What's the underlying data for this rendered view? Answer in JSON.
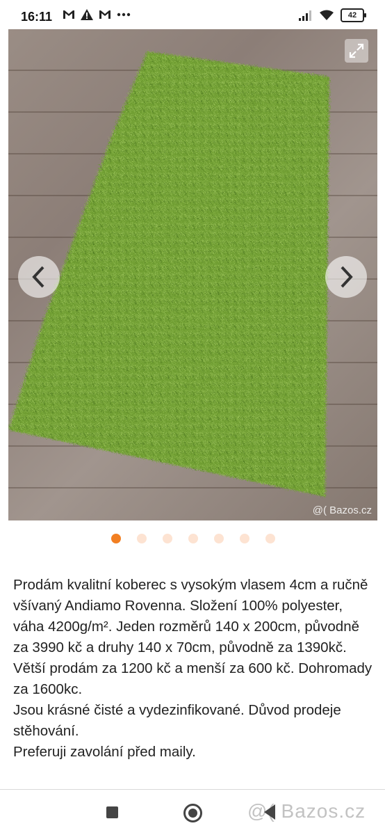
{
  "status_bar": {
    "time": "16:11",
    "left_icons": [
      "gmail-icon",
      "alert-icon",
      "gmail-icon",
      "more-dots-icon"
    ],
    "battery": "42"
  },
  "gallery": {
    "watermark": "@( Bazos.cz",
    "dot_count": 7,
    "active_index": 0,
    "accent": "#f27f22"
  },
  "description": "Prodám kvalitní koberec s vysokým vlasem 4cm a ručně všívaný Andiamo Rovenna. Složení 100% polyester, váha 4200g/m². Jeden rozměrů 140 x 200cm, původně za 3990 kč a druhy 140 x 70cm, původně za 1390kč.\nVětší prodám za 1200 kč a menší za 600 kč. Dohromady za 1600kc.\nJsou krásné čisté a vydezinfikované. Důvod prodeje stěhování.\nPreferuji zavolání před maily.",
  "navbar": {
    "watermark": "@( Bazos.cz"
  }
}
